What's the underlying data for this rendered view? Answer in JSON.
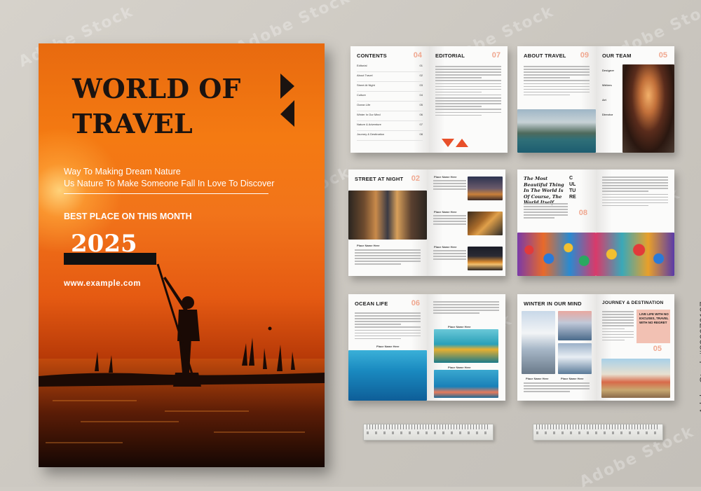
{
  "cover": {
    "title_line1": "WORLD OF",
    "title_line2": "TRAVEL",
    "subtitle_line1": "Way To Making Dream Nature",
    "subtitle_line2": "Us Nature To Make Someone Fall In Love To Discover",
    "best_place": "BEST PLACE ON THIS MONTH",
    "year": "2025",
    "url": "www.example.com"
  },
  "spreads": [
    {
      "left_title": "CONTENTS",
      "left_num": "04",
      "right_title": "EDITORIAL",
      "right_num": "07"
    },
    {
      "left_title": "ABOUT TRAVEL",
      "left_num": "09",
      "right_title": "OUR TEAM",
      "right_num": "05"
    },
    {
      "left_title": "STREET AT NIGHT",
      "left_num": "02",
      "right_title": "",
      "right_num": ""
    },
    {
      "left_title": "The Most Beautiful Thing In The World Is Of Course, The World Itself",
      "left_num": "08",
      "right_title": "CULTURE",
      "right_num": ""
    },
    {
      "left_title": "OCEAN LIFE",
      "left_num": "06",
      "right_title": "",
      "right_num": ""
    },
    {
      "left_title": "WINTER IN OUR MIND",
      "left_num": "09",
      "right_title": "JOURNEY & DESTINATION",
      "right_num": "05"
    }
  ],
  "contents_items": [
    {
      "label": "Editorial",
      "page": "01"
    },
    {
      "label": "About Travel",
      "page": "02"
    },
    {
      "label": "Street At Night",
      "page": "03"
    },
    {
      "label": "Culture",
      "page": "04"
    },
    {
      "label": "Ocean Life",
      "page": "05"
    },
    {
      "label": "Winter In Our Mind",
      "page": "06"
    },
    {
      "label": "Nature & Adventure",
      "page": "07"
    },
    {
      "label": "Journey & Destination",
      "page": "08"
    }
  ],
  "team_roles": [
    "Designer",
    "Writers",
    "Art",
    "Director"
  ],
  "captions": {
    "place_name": "Place Name Here"
  },
  "journey_callout": "LIVE LIFE WITH NO EXCUSES, TRAVEL WITH NO REGRET",
  "stock": {
    "watermark": "Adobe Stock",
    "id": "#839076137"
  },
  "colors": {
    "accent_orange": "#f47a12",
    "accent_salmon": "#f0a890",
    "callout_pink": "#f2c1b3",
    "ink": "#1b1310"
  }
}
